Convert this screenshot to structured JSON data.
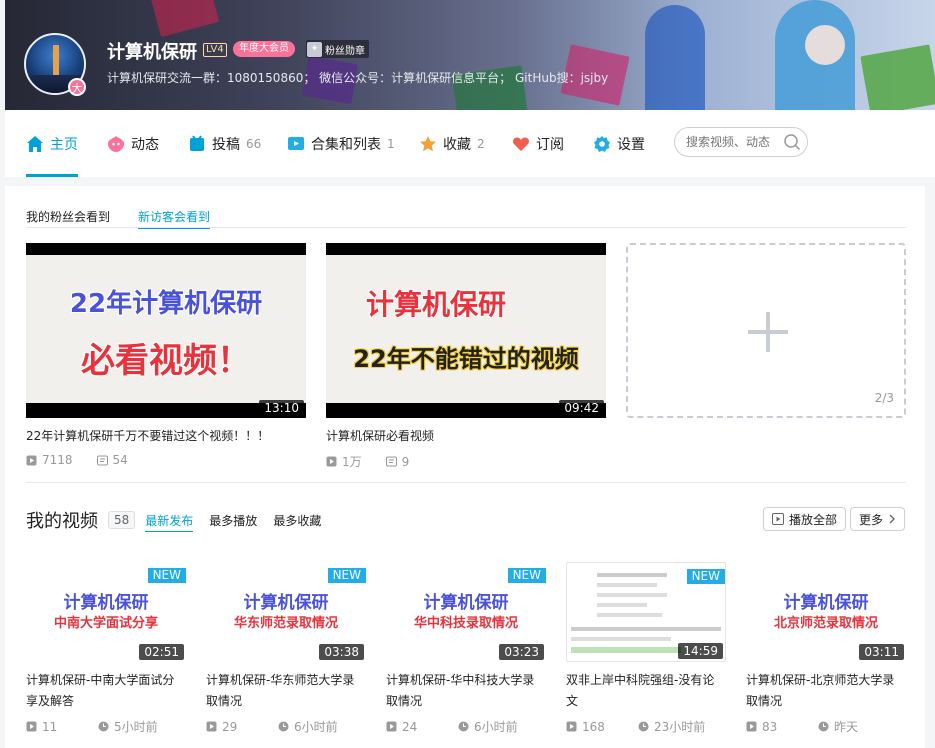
{
  "profile": {
    "name": "计算机保研",
    "level": "LV4",
    "vip_tag": "年度大会员",
    "fan_medal": "粉丝勋章",
    "avatar_badge": "大",
    "sign": "计算机保研交流一群：1080150860； 微信公众号：计算机保研信息平台； GitHub搜：jsjby"
  },
  "nav": {
    "items": [
      {
        "label": "主页",
        "count": "",
        "icon": "home-icon",
        "color": "#00a1d6"
      },
      {
        "label": "动态",
        "count": "",
        "icon": "dynamic-icon",
        "color": "#fb7299"
      },
      {
        "label": "投稿",
        "count": "66",
        "icon": "upload-icon",
        "color": "#00a1d6"
      },
      {
        "label": "合集和列表",
        "count": "1",
        "icon": "collection-icon",
        "color": "#23ade5"
      },
      {
        "label": "收藏",
        "count": "2",
        "icon": "star-icon",
        "color": "#f3a034"
      },
      {
        "label": "订阅",
        "count": "",
        "icon": "heart-icon",
        "color": "#f25d4e"
      },
      {
        "label": "设置",
        "count": "",
        "icon": "gear-icon",
        "color": "#23ade5"
      }
    ],
    "search_placeholder": "搜索视频、动态"
  },
  "top": {
    "tabs": [
      "我的粉丝会看到",
      "新访客会看到"
    ],
    "videos": [
      {
        "thumb_line1": "22年计算机保研",
        "thumb_line2": "必看视频！",
        "duration": "13:10",
        "title": "22年计算机保研千万不要错过这个视频！！！",
        "plays": "7118",
        "danmaku": "54"
      },
      {
        "thumb_line1": "计算机保研",
        "thumb_line2": "22年不能错过的视频",
        "duration": "09:42",
        "title": "计算机保研必看视频",
        "plays": "1万",
        "danmaku": "9"
      }
    ],
    "placeholder_page": "2/3"
  },
  "my_videos": {
    "title": "我的视频",
    "count": "58",
    "sorts": [
      "最新发布",
      "最多播放",
      "最多收藏"
    ],
    "play_all": "播放全部",
    "more": "更多",
    "new_badge": "NEW",
    "items": [
      {
        "thumb_line1": "计算机保研",
        "thumb_line2": "中南大学面试分享",
        "duration": "02:51",
        "title": "计算机保研-中南大学面试分享及解答",
        "plays": "11",
        "time": "5小时前"
      },
      {
        "thumb_line1": "计算机保研",
        "thumb_line2": "华东师范录取情况",
        "duration": "03:38",
        "title": "计算机保研-华东师范大学录取情况",
        "plays": "29",
        "time": "6小时前"
      },
      {
        "thumb_line1": "计算机保研",
        "thumb_line2": "华中科技录取情况",
        "duration": "03:23",
        "title": "计算机保研-华中科技大学录取情况",
        "plays": "24",
        "time": "6小时前"
      },
      {
        "thumb_line1": "",
        "thumb_line2": "",
        "duration": "14:59",
        "title": "双非上岸中科院强组-没有论文",
        "plays": "168",
        "time": "23小时前"
      },
      {
        "thumb_line1": "计算机保研",
        "thumb_line2": "北京师范录取情况",
        "duration": "03:11",
        "title": "计算机保研-北京师范大学录取情况",
        "plays": "83",
        "time": "昨天"
      }
    ]
  }
}
